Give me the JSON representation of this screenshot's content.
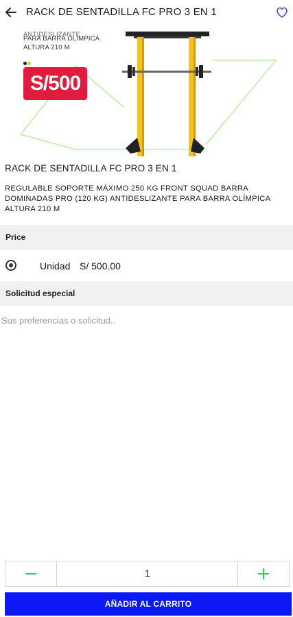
{
  "header": {
    "title": "RACK DE SENTADILLA FC PRO 3 EN 1",
    "back_icon": "arrow-left-icon",
    "favorite_icon": "heart-outline-icon"
  },
  "banner": {
    "text_cut": "ANTIDESLIZANTE",
    "text_line1": "PARA BARRA OLÍMPICA",
    "text_line2": "ALTURA 210 M",
    "price": "S/500",
    "colors": {
      "badge": "#e11b3d",
      "frame": "#f2c318",
      "accent_lines": "#b8f0a0"
    }
  },
  "product": {
    "name": "RACK DE SENTADILLA FC PRO 3 EN 1",
    "description": "REGULABLE SOPORTE MÁXIMO 250 KG FRONT SQUAD BARRA DOMINADAS PRO (120 KG) ANTIDESLIZANTE PARA BARRA OLÍMPICA ALTURA 210 M"
  },
  "price_section": {
    "title": "Price",
    "option_label": "Unidad",
    "option_price": "S/ 500.00",
    "selected": true
  },
  "request_section": {
    "title": "Solicitud especial",
    "placeholder": "Sus preferencias o solicitud.."
  },
  "stepper": {
    "quantity": "1",
    "minus_color": "#2ecc5a",
    "plus_color": "#2ecc5a"
  },
  "cart_button": {
    "label": "AÑADIR AL CARRITO",
    "color": "#0b19f5"
  }
}
